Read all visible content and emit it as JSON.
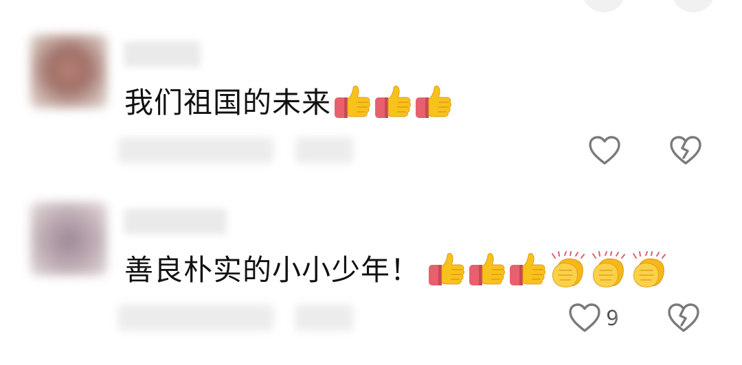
{
  "comments": [
    {
      "text": "我们祖国的未来",
      "emojis": [
        "thumbs-up",
        "thumbs-up",
        "thumbs-up"
      ],
      "like_count": ""
    },
    {
      "text": "善良朴实的小小少年！",
      "emojis": [
        "thumbs-up",
        "thumbs-up",
        "thumbs-up",
        "clapping-hands",
        "clapping-hands",
        "clapping-hands"
      ],
      "like_count": "9"
    }
  ],
  "colors": {
    "icon_stroke": "#7a7a7a",
    "emoji_yellow": "#f8c21c",
    "emoji_sleeve": "#e8606d",
    "text": "#111111"
  }
}
